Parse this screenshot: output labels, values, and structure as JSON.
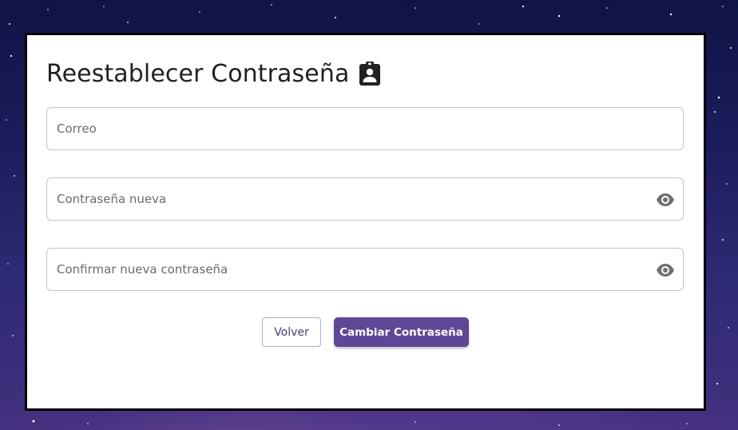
{
  "page": {
    "title": "Reestablecer Contraseña",
    "title_icon": "assignment-ind-icon"
  },
  "form": {
    "email": {
      "value": "",
      "placeholder": "Correo"
    },
    "new_password": {
      "value": "",
      "placeholder": "Contraseña nueva",
      "icon": "eye-icon"
    },
    "confirm_password": {
      "value": "",
      "placeholder": "Confirmar nueva contraseña",
      "icon": "eye-icon"
    }
  },
  "actions": {
    "back_label": "Volver",
    "submit_label": "Cambiar Contraseña"
  },
  "colors": {
    "primary": "#5f4796",
    "card_border": "#000000",
    "field_border": "#c4c4c4"
  }
}
